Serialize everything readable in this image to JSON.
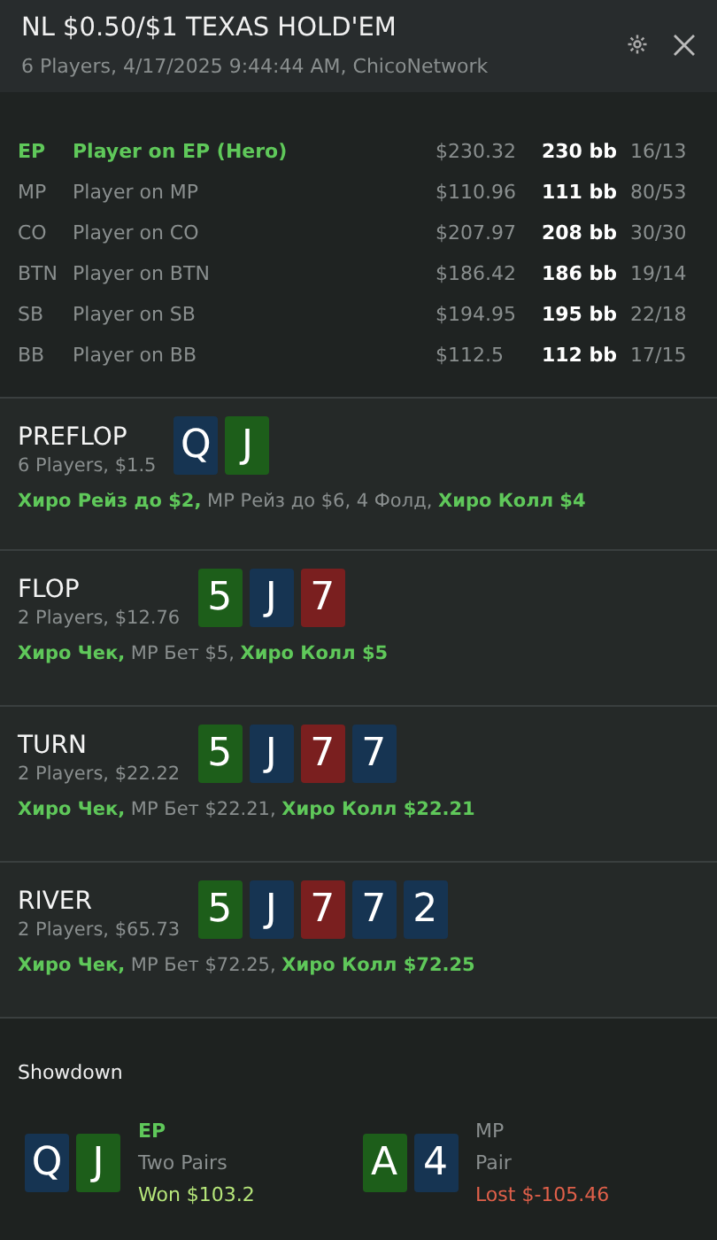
{
  "header": {
    "title": "NL $0.50/$1 TEXAS HOLD'EM",
    "subtitle": "6 Players, 4/17/2025 9:44:44 AM, ChicoNetwork"
  },
  "players": [
    {
      "position": "EP",
      "name": "Player on EP (Hero)",
      "stack": "$230.32",
      "bb": "230 bb",
      "stats": "16/13",
      "hero": true
    },
    {
      "position": "MP",
      "name": "Player on MP",
      "stack": "$110.96",
      "bb": "111 bb",
      "stats": "80/53",
      "hero": false
    },
    {
      "position": "CO",
      "name": "Player on CO",
      "stack": "$207.97",
      "bb": "208 bb",
      "stats": "30/30",
      "hero": false
    },
    {
      "position": "BTN",
      "name": "Player on BTN",
      "stack": "$186.42",
      "bb": "186 bb",
      "stats": "19/14",
      "hero": false
    },
    {
      "position": "SB",
      "name": "Player on SB",
      "stack": "$194.95",
      "bb": "195 bb",
      "stats": "22/18",
      "hero": false
    },
    {
      "position": "BB",
      "name": "Player on BB",
      "stack": "$112.5",
      "bb": "112 bb",
      "stats": "17/15",
      "hero": false
    }
  ],
  "streets": [
    {
      "name": "PREFLOP",
      "info": "6 Players, $1.5",
      "cards": [
        {
          "rank": "Q",
          "color": "#163452"
        },
        {
          "rank": "J",
          "color": "#1d5e1a"
        }
      ],
      "actions": "**Хиро Рейз до $2,** MP Рейз до $6, 4 Фолд, **Хиро Колл $4**"
    },
    {
      "name": "FLOP",
      "info": "2 Players, $12.76",
      "cards": [
        {
          "rank": "5",
          "color": "#1d5e1a"
        },
        {
          "rank": "J",
          "color": "#163452"
        },
        {
          "rank": "7",
          "color": "#7a1f1f"
        }
      ],
      "actions": "**Хиро Чек,** MP Бет $5, **Хиро Колл $5**"
    },
    {
      "name": "TURN",
      "info": "2 Players, $22.22",
      "cards": [
        {
          "rank": "5",
          "color": "#1d5e1a"
        },
        {
          "rank": "J",
          "color": "#163452"
        },
        {
          "rank": "7",
          "color": "#7a1f1f"
        },
        {
          "rank": "7",
          "color": "#163452"
        }
      ],
      "actions": "**Хиро Чек,** MP Бет $22.21, **Хиро Колл $22.21**"
    },
    {
      "name": "RIVER",
      "info": "2 Players, $65.73",
      "cards": [
        {
          "rank": "5",
          "color": "#1d5e1a"
        },
        {
          "rank": "J",
          "color": "#163452"
        },
        {
          "rank": "7",
          "color": "#7a1f1f"
        },
        {
          "rank": "7",
          "color": "#163452"
        },
        {
          "rank": "2",
          "color": "#163452"
        }
      ],
      "actions": "**Хиро Чек,** MP Бет $72.25, **Хиро Колл $72.25**"
    }
  ],
  "showdown": {
    "title": "Showdown",
    "hands": [
      {
        "position": "EP",
        "hero": true,
        "cards": [
          {
            "rank": "Q",
            "color": "#163452"
          },
          {
            "rank": "J",
            "color": "#1d5e1a"
          }
        ],
        "hand": "Two Pairs",
        "result": "Won $103.2",
        "won": true
      },
      {
        "position": "MP",
        "hero": false,
        "cards": [
          {
            "rank": "A",
            "color": "#1d5e1a"
          },
          {
            "rank": "4",
            "color": "#163452"
          }
        ],
        "hand": "Pair",
        "result": "Lost $-105.46",
        "won": false
      }
    ]
  }
}
